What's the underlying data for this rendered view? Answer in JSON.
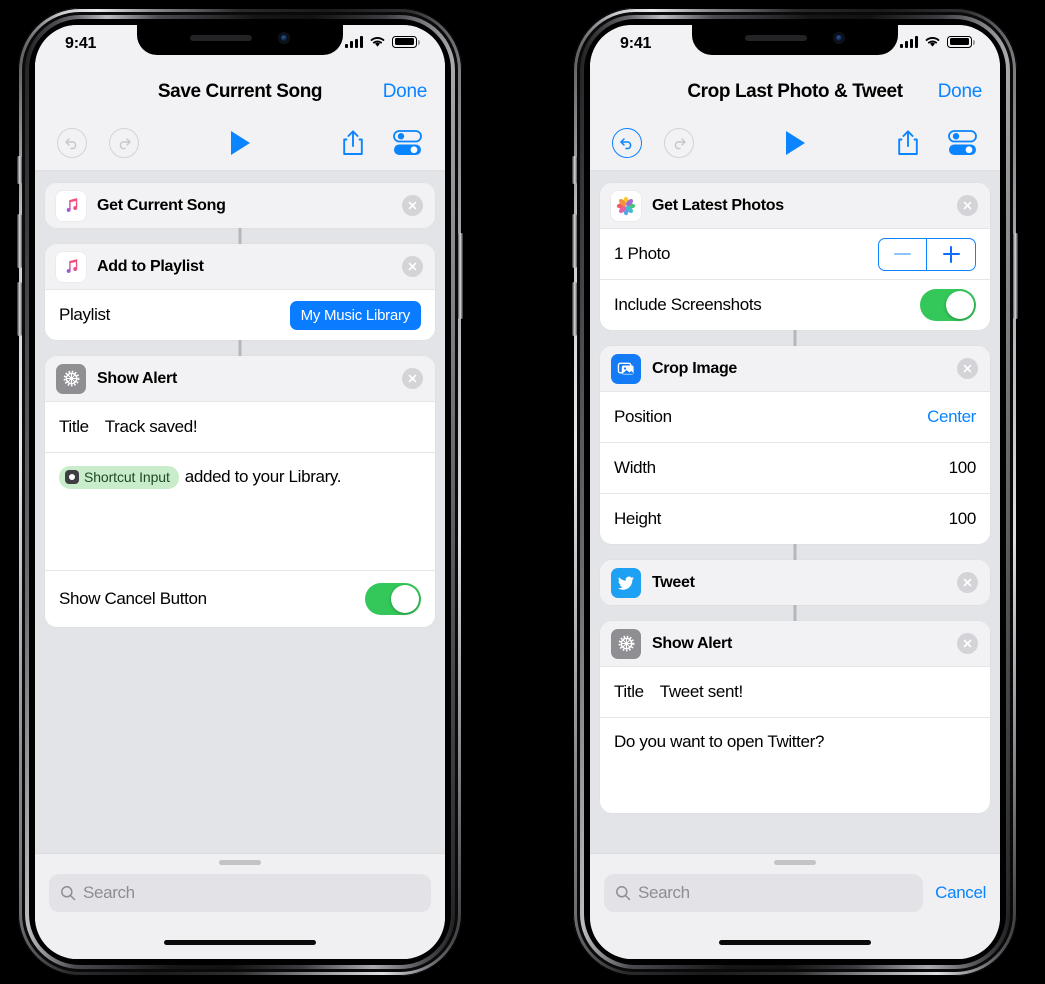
{
  "phones": [
    {
      "id": "left",
      "status_bar": {
        "time": "9:41",
        "cellular": "signal-bars",
        "wifi": "wifi-icon",
        "battery": "battery-icon"
      },
      "nav": {
        "title": "Save Current Song",
        "done_label": "Done"
      },
      "toolbar": {
        "undo": "undo-icon",
        "redo": "redo-icon",
        "play": "play-icon",
        "share": "share-icon",
        "settings": "settings-icon",
        "undo_enabled": false,
        "redo_enabled": false
      },
      "actions": [
        {
          "title": "Get Current Song",
          "icon": "apple-music-icon",
          "rows": []
        },
        {
          "title": "Add to Playlist",
          "icon": "apple-music-icon",
          "rows": [
            {
              "type": "pill",
              "label": "Playlist",
              "value": "My Music Library"
            }
          ]
        },
        {
          "title": "Show Alert",
          "icon": "gear-icon",
          "rows": [
            {
              "type": "value",
              "label": "Title",
              "value": "Track saved!",
              "inline": true
            },
            {
              "type": "text",
              "token": "Shortcut Input",
              "text": "added to your Library."
            },
            {
              "type": "toggle",
              "label": "Show Cancel Button",
              "on": true
            }
          ]
        }
      ],
      "search": {
        "placeholder": "Search",
        "cancel_label": null
      }
    },
    {
      "id": "right",
      "status_bar": {
        "time": "9:41",
        "cellular": "signal-bars",
        "wifi": "wifi-icon",
        "battery": "battery-icon"
      },
      "nav": {
        "title": "Crop Last Photo & Tweet",
        "done_label": "Done"
      },
      "toolbar": {
        "undo": "undo-icon",
        "redo": "redo-icon",
        "play": "play-icon",
        "share": "share-icon",
        "settings": "settings-icon",
        "undo_enabled": true,
        "redo_enabled": false
      },
      "actions": [
        {
          "title": "Get Latest Photos",
          "icon": "photos-icon",
          "rows": [
            {
              "type": "stepper",
              "label": "1 Photo",
              "minus_enabled": false,
              "plus_enabled": true
            },
            {
              "type": "toggle",
              "label": "Include Screenshots",
              "on": true
            }
          ]
        },
        {
          "title": "Crop Image",
          "icon": "crop-image-icon",
          "rows": [
            {
              "type": "value",
              "label": "Position",
              "value": "Center",
              "blue": true
            },
            {
              "type": "value",
              "label": "Width",
              "value": "100"
            },
            {
              "type": "value",
              "label": "Height",
              "value": "100"
            }
          ]
        },
        {
          "title": "Tweet",
          "icon": "twitter-icon",
          "rows": []
        },
        {
          "title": "Show Alert",
          "icon": "gear-icon",
          "rows": [
            {
              "type": "value",
              "label": "Title",
              "value": "Tweet sent!",
              "inline": true
            },
            {
              "type": "text",
              "token": null,
              "text": "Do you want to open Twitter?"
            }
          ]
        }
      ],
      "search": {
        "placeholder": "Search",
        "cancel_label": "Cancel"
      }
    }
  ],
  "colors": {
    "accent_blue": "#0a84ff",
    "toggle_green": "#34c759",
    "pill_blue": "#0a7cff",
    "token_green_bg": "#c9edca",
    "background_gray": "#e3e4e8"
  }
}
